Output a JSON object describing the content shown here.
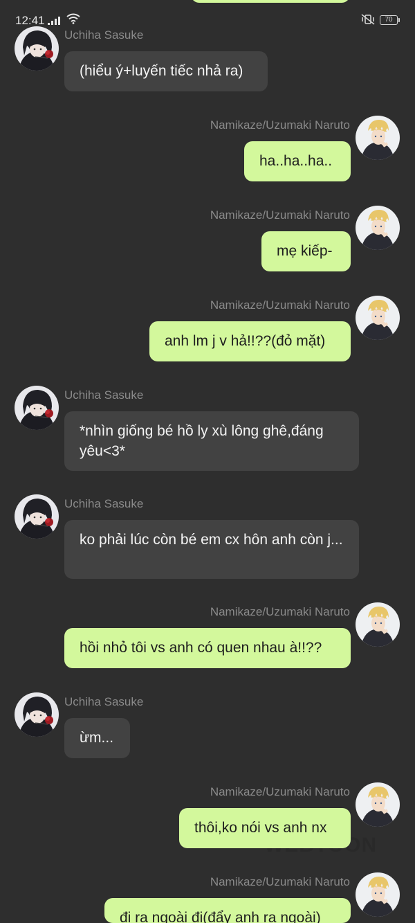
{
  "status_bar": {
    "time": "12:41",
    "battery": "70",
    "icons": [
      "signal-icon",
      "wifi-icon",
      "vibrate-mute-icon",
      "battery-icon"
    ]
  },
  "characters": {
    "sasuke": {
      "name": "Uchiha Sasuke",
      "avatar": "sasuke-avatar"
    },
    "naruto": {
      "name": "Namikaze/Uzumaki Naruto",
      "avatar": "naruto-avatar"
    }
  },
  "messages": [
    {
      "sender": "Uchiha Sasuke",
      "side": "left",
      "text": "(hiểu ý+luyến tiếc nhả ra)"
    },
    {
      "sender": "Namikaze/Uzumaki Naruto",
      "side": "right",
      "text": "ha..ha..ha.."
    },
    {
      "sender": "Namikaze/Uzumaki Naruto",
      "side": "right",
      "text": "mẹ kiếp-"
    },
    {
      "sender": "Namikaze/Uzumaki Naruto",
      "side": "right",
      "text": "anh lm j v hả!!??(đỏ mặt)"
    },
    {
      "sender": "Uchiha Sasuke",
      "side": "left",
      "text": "*nhìn giống bé hồ ly xù lông ghê,đáng yêu<3*"
    },
    {
      "sender": "Uchiha Sasuke",
      "side": "left",
      "text": "ko phải lúc còn bé em cx hôn anh còn j..."
    },
    {
      "sender": "Namikaze/Uzumaki Naruto",
      "side": "right",
      "text": "hồi nhỏ tôi vs anh có quen nhau à!!??"
    },
    {
      "sender": "Uchiha Sasuke",
      "side": "left",
      "text": "ừm..."
    },
    {
      "sender": "Namikaze/Uzumaki Naruto",
      "side": "right",
      "text": "thôi,ko nói vs anh nx"
    },
    {
      "sender": "Namikaze/Uzumaki Naruto",
      "side": "right",
      "text": "đi ra ngoài đi(đẩy anh ra ngoài)"
    }
  ],
  "watermark": "WEBTOON",
  "colors": {
    "background": "#2e2e2e",
    "left_bubble": "#424242",
    "right_bubble": "#d3f89c",
    "name_text": "#8a8a8a"
  }
}
